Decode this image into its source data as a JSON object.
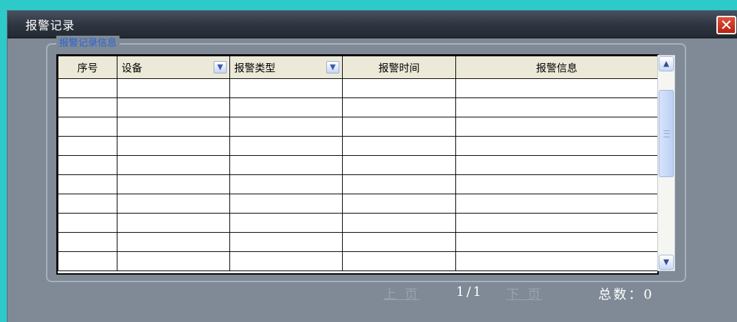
{
  "window": {
    "title": "报警记录",
    "close_glyph": "✕"
  },
  "group": {
    "label": "报警记录信息"
  },
  "table": {
    "columns": [
      {
        "label": "序号",
        "dropdown": false
      },
      {
        "label": "设备",
        "dropdown": true
      },
      {
        "label": "报警类型",
        "dropdown": true
      },
      {
        "label": "报警时间",
        "dropdown": false
      },
      {
        "label": "报警信息",
        "dropdown": false
      }
    ],
    "rows": [
      [
        "",
        "",
        "",
        "",
        ""
      ],
      [
        "",
        "",
        "",
        "",
        ""
      ],
      [
        "",
        "",
        "",
        "",
        ""
      ],
      [
        "",
        "",
        "",
        "",
        ""
      ],
      [
        "",
        "",
        "",
        "",
        ""
      ],
      [
        "",
        "",
        "",
        "",
        ""
      ],
      [
        "",
        "",
        "",
        "",
        ""
      ],
      [
        "",
        "",
        "",
        "",
        ""
      ],
      [
        "",
        "",
        "",
        "",
        ""
      ],
      [
        "",
        "",
        "",
        "",
        ""
      ]
    ]
  },
  "scrollbar": {
    "up_glyph": "▲",
    "down_glyph": "▼"
  },
  "pager": {
    "prev_label": "上 页",
    "page_indicator": "1/1",
    "next_label": "下 页",
    "total_label": "总数：0"
  },
  "icons": {
    "close": "close-icon",
    "dropdown": "chevron-down-icon",
    "scroll_up": "arrow-up-icon",
    "scroll_down": "arrow-down-icon"
  },
  "colors": {
    "background": "#2ec9c9",
    "window": "#7f8a96",
    "titlebar": "#2e3540",
    "close": "#c0301a",
    "group_label": "#2b63d8",
    "header_bg": "#ece9d8"
  }
}
